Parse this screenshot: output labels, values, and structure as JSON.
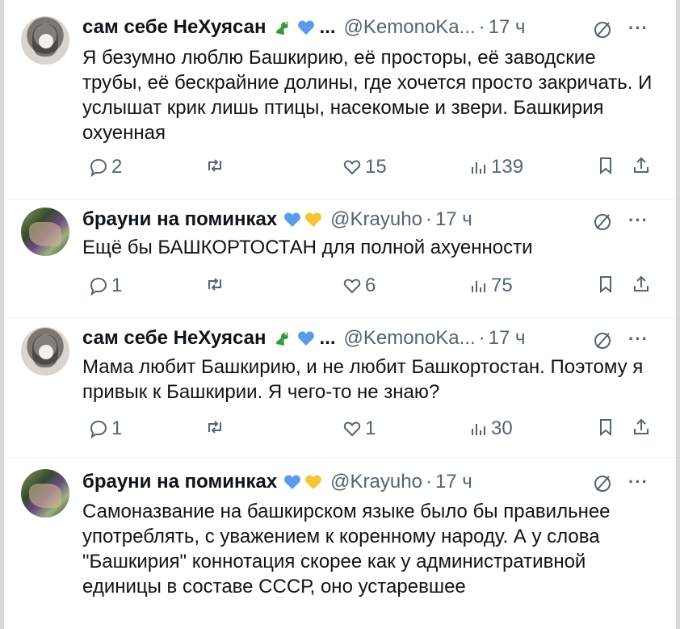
{
  "tweets": [
    {
      "name": "сам себе НеХуясан",
      "emojis": [
        "dragon-icon",
        "blue-heart-icon"
      ],
      "ellipsis": "...",
      "handle": "@KemonoKa...",
      "time": "17 ч",
      "text": "Я безумно люблю Башкирию, её просторы, её заводские трубы, её бескрайние долины, где хочется просто закричать. И услышат крик лишь птицы, насекомые и звери. Башкирия охуенная",
      "replies": "2",
      "reposts": "",
      "likes": "15",
      "views": "139"
    },
    {
      "name": "брауни на поминках",
      "emojis": [
        "blue-heart-icon",
        "yellow-heart-icon"
      ],
      "ellipsis": "",
      "handle": "@Krayuho",
      "time": "17 ч",
      "text": "Ещё бы БАШКОРТОСТАН для полной ахуенности",
      "replies": "1",
      "reposts": "",
      "likes": "6",
      "views": "75"
    },
    {
      "name": "сам себе НеХуясан",
      "emojis": [
        "dragon-icon",
        "blue-heart-icon"
      ],
      "ellipsis": "...",
      "handle": "@KemonoKa...",
      "time": "17 ч",
      "text": "Мама любит Башкирию, и не любит Башкортостан. Поэтому я привык к Башкирии. Я чего-то не знаю?",
      "replies": "1",
      "reposts": "",
      "likes": "1",
      "views": "30"
    },
    {
      "name": "брауни на поминках",
      "emojis": [
        "blue-heart-icon",
        "yellow-heart-icon"
      ],
      "ellipsis": "",
      "handle": "@Krayuho",
      "time": "17 ч",
      "text": "Самоназвание на башкирском языке было бы правильнее употреблять, с уважением к коренному народу. А у слова \"Башкирия\" коннотация скорее как у административной единицы в составе СССР, оно устаревшее"
    }
  ],
  "separator": "·",
  "more_label": "···",
  "colors": {
    "text": "#0f1419",
    "muted": "#536471",
    "blue_heart": "#5b9bea",
    "yellow_heart": "#f5c536",
    "dragon": "#3a9a3a"
  }
}
